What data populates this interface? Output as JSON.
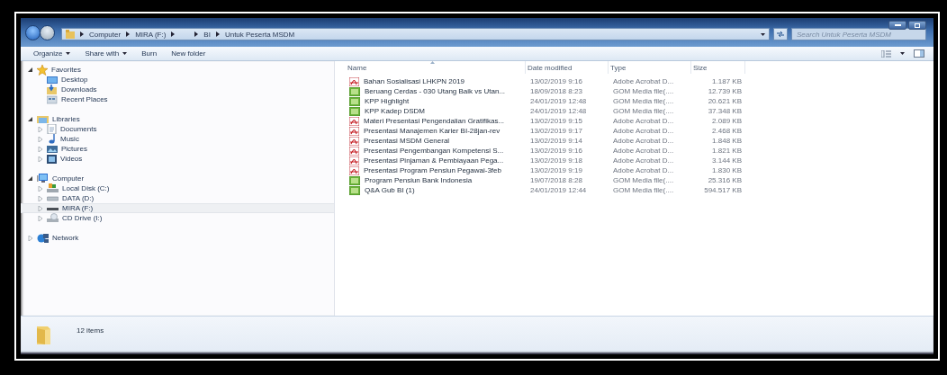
{
  "window": {
    "caption_buttons": [
      {
        "kind": "minimize"
      },
      {
        "kind": "maximize"
      }
    ]
  },
  "address_bar": {
    "segments": [
      {
        "kind": "folder",
        "label": "Computer"
      },
      {
        "kind": "folder",
        "label": "MIRA (F:)"
      },
      {
        "kind": "gap"
      },
      {
        "kind": "folder",
        "label": "BI"
      },
      {
        "kind": "folder",
        "label": "Untuk Peserta MSDM"
      }
    ]
  },
  "search": {
    "placeholder": "Search Untuk Peserta MSDM"
  },
  "toolbar": {
    "items": [
      {
        "label": "Organize",
        "dropdown": true
      },
      {
        "label": "Share with",
        "dropdown": true
      },
      {
        "label": "Burn",
        "dropdown": false
      },
      {
        "label": "New folder",
        "dropdown": false
      }
    ]
  },
  "sidebar": {
    "groups": [
      {
        "label": "Favorites",
        "kind": "star",
        "expanded": true,
        "children": [
          {
            "label": "Desktop",
            "kind": "desktop",
            "selected": false
          },
          {
            "label": "Downloads",
            "kind": "downloads",
            "selected": false
          },
          {
            "label": "Recent Places",
            "kind": "recent",
            "selected": false
          }
        ]
      },
      {
        "label": "Libraries",
        "kind": "library",
        "expanded": true,
        "children": [
          {
            "label": "Documents",
            "kind": "documents",
            "expanded": false,
            "selected": false
          },
          {
            "label": "Music",
            "kind": "music",
            "expanded": false,
            "selected": false
          },
          {
            "label": "Pictures",
            "kind": "pictures",
            "expanded": false,
            "selected": false
          },
          {
            "label": "Videos",
            "kind": "videos",
            "expanded": false,
            "selected": false
          }
        ]
      },
      {
        "label": "Computer",
        "kind": "computer",
        "expanded": true,
        "children": [
          {
            "label": "Local Disk (C:)",
            "kind": "system-disk",
            "expanded": false,
            "selected": false
          },
          {
            "label": "DATA (D:)",
            "kind": "drive",
            "expanded": false,
            "selected": false
          },
          {
            "label": "MIRA (F:)",
            "kind": "usb",
            "expanded": false,
            "selected": true
          },
          {
            "label": "CD Drive (I:)",
            "kind": "cd",
            "expanded": false,
            "selected": false
          }
        ]
      },
      {
        "label": "Network",
        "kind": "network",
        "expanded": false
      }
    ]
  },
  "file_list": {
    "columns": [
      {
        "label": "Name",
        "sorted": true
      },
      {
        "label": "Date modified",
        "sorted": false
      },
      {
        "label": "Type",
        "sorted": false
      },
      {
        "label": "Size",
        "sorted": false
      }
    ],
    "rows": [
      {
        "kind": "pdf",
        "name": "Bahan Sosialisasi LHKPN 2019",
        "date": "13/02/2019 9:16",
        "type": "Adobe Acrobat D...",
        "size": "1.187 KB"
      },
      {
        "kind": "video",
        "name": "Beruang Cerdas - 030 Utang Baik vs Utan...",
        "date": "18/09/2018 8:23",
        "type": "GOM Media file(....",
        "size": "12.739 KB"
      },
      {
        "kind": "video",
        "name": "KPP Highlight",
        "date": "24/01/2019 12:48",
        "type": "GOM Media file(....",
        "size": "20.621 KB"
      },
      {
        "kind": "video",
        "name": "KPP Kadep DSDM",
        "date": "24/01/2019 12:48",
        "type": "GOM Media file(....",
        "size": "37.348 KB"
      },
      {
        "kind": "pdf",
        "name": "Materi Presentasi Pengendalian Gratifikas...",
        "date": "13/02/2019 9:15",
        "type": "Adobe Acrobat D...",
        "size": "2.089 KB"
      },
      {
        "kind": "pdf",
        "name": "Presentasi Manajemen Karier BI-28jan-rev",
        "date": "13/02/2019 9:17",
        "type": "Adobe Acrobat D...",
        "size": "2.468 KB"
      },
      {
        "kind": "pdf",
        "name": "Presentasi MSDM General",
        "date": "13/02/2019 9:14",
        "type": "Adobe Acrobat D...",
        "size": "1.848 KB"
      },
      {
        "kind": "pdf",
        "name": "Presentasi Pengembangan Kompetensi S...",
        "date": "13/02/2019 9:16",
        "type": "Adobe Acrobat D...",
        "size": "1.821 KB"
      },
      {
        "kind": "pdf",
        "name": "Presentasi Pinjaman & Pembiayaan Pega...",
        "date": "13/02/2019 9:18",
        "type": "Adobe Acrobat D...",
        "size": "3.144 KB"
      },
      {
        "kind": "pdf",
        "name": "Presentasi Program Pensiun Pegawai-3feb",
        "date": "13/02/2019 9:19",
        "type": "Adobe Acrobat D...",
        "size": "1.830 KB"
      },
      {
        "kind": "video",
        "name": "Program Pensiun Bank Indonesia",
        "date": "19/07/2018 8:28",
        "type": "GOM Media file(....",
        "size": "25.316 KB"
      },
      {
        "kind": "video",
        "name": "Q&A Gub BI (1)",
        "date": "24/01/2019 12:44",
        "type": "GOM Media file(....",
        "size": "594.517 KB"
      }
    ]
  },
  "status_bar": {
    "count": "12 items"
  }
}
